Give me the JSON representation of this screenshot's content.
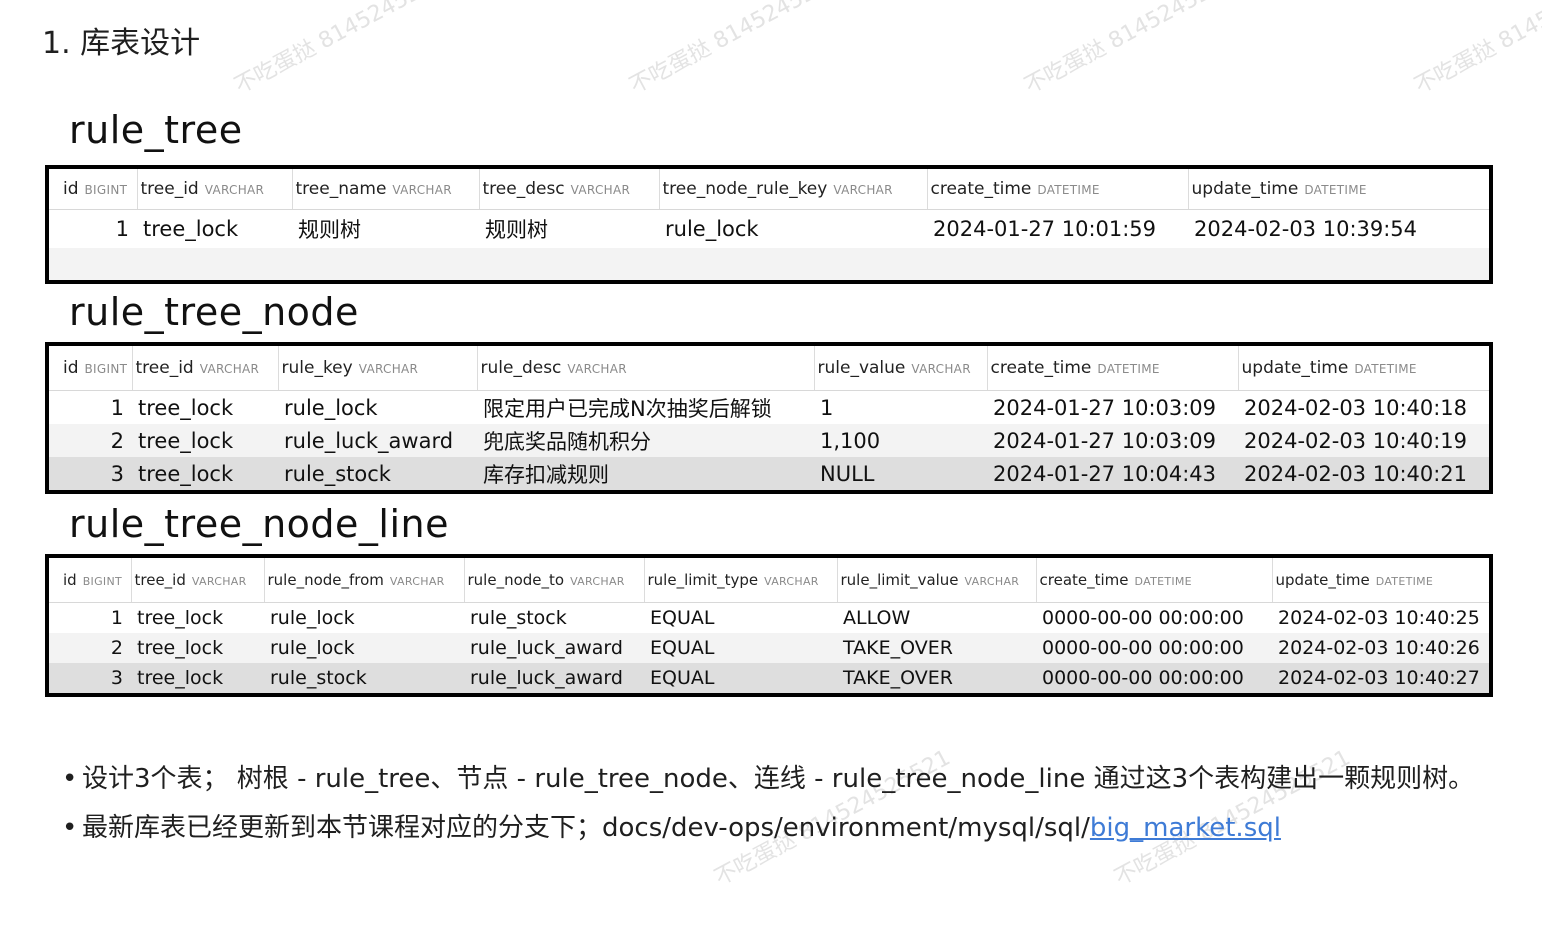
{
  "heading": "1. 库表设计",
  "watermark_text": "不吃蛋挞 814524525521",
  "tables": [
    {
      "name": "rule_tree",
      "columns": [
        {
          "name": "id",
          "type": "BIGINT"
        },
        {
          "name": "tree_id",
          "type": "VARCHAR"
        },
        {
          "name": "tree_name",
          "type": "VARCHAR"
        },
        {
          "name": "tree_desc",
          "type": "VARCHAR"
        },
        {
          "name": "tree_node_rule_key",
          "type": "VARCHAR"
        },
        {
          "name": "create_time",
          "type": "DATETIME"
        },
        {
          "name": "update_time",
          "type": "DATETIME"
        }
      ],
      "rows": [
        [
          "1",
          "tree_lock",
          "规则树",
          "规则树",
          "rule_lock",
          "2024-01-27 10:01:59",
          "2024-02-03 10:39:54"
        ]
      ]
    },
    {
      "name": "rule_tree_node",
      "columns": [
        {
          "name": "id",
          "type": "BIGINT"
        },
        {
          "name": "tree_id",
          "type": "VARCHAR"
        },
        {
          "name": "rule_key",
          "type": "VARCHAR"
        },
        {
          "name": "rule_desc",
          "type": "VARCHAR"
        },
        {
          "name": "rule_value",
          "type": "VARCHAR"
        },
        {
          "name": "create_time",
          "type": "DATETIME"
        },
        {
          "name": "update_time",
          "type": "DATETIME"
        }
      ],
      "rows": [
        [
          "1",
          "tree_lock",
          "rule_lock",
          "限定用户已完成N次抽奖后解锁",
          "1",
          "2024-01-27 10:03:09",
          "2024-02-03 10:40:18"
        ],
        [
          "2",
          "tree_lock",
          "rule_luck_award",
          "兜底奖品随机积分",
          "1,100",
          "2024-01-27 10:03:09",
          "2024-02-03 10:40:19"
        ],
        [
          "3",
          "tree_lock",
          "rule_stock",
          "库存扣减规则",
          "NULL",
          "2024-01-27 10:04:43",
          "2024-02-03 10:40:21"
        ]
      ]
    },
    {
      "name": "rule_tree_node_line",
      "columns": [
        {
          "name": "id",
          "type": "BIGINT"
        },
        {
          "name": "tree_id",
          "type": "VARCHAR"
        },
        {
          "name": "rule_node_from",
          "type": "VARCHAR"
        },
        {
          "name": "rule_node_to",
          "type": "VARCHAR"
        },
        {
          "name": "rule_limit_type",
          "type": "VARCHAR"
        },
        {
          "name": "rule_limit_value",
          "type": "VARCHAR"
        },
        {
          "name": "create_time",
          "type": "DATETIME"
        },
        {
          "name": "update_time",
          "type": "DATETIME"
        }
      ],
      "rows": [
        [
          "1",
          "tree_lock",
          "rule_lock",
          "rule_stock",
          "EQUAL",
          "ALLOW",
          "0000-00-00 00:00:00",
          "2024-02-03 10:40:25"
        ],
        [
          "2",
          "tree_lock",
          "rule_lock",
          "rule_luck_award",
          "EQUAL",
          "TAKE_OVER",
          "0000-00-00 00:00:00",
          "2024-02-03 10:40:26"
        ],
        [
          "3",
          "tree_lock",
          "rule_stock",
          "rule_luck_award",
          "EQUAL",
          "TAKE_OVER",
          "0000-00-00 00:00:00",
          "2024-02-03 10:40:27"
        ]
      ]
    }
  ],
  "bullets": {
    "b1": "设计3个表； 树根 - rule_tree、节点 - rule_tree_node、连线 - rule_tree_node_line 通过这3个表构建出一颗规则树。",
    "b2_text": "最新库表已经更新到本节课程对应的分支下；docs/dev-ops/environment/mysql/sql/",
    "b2_link": "big_market.sql"
  },
  "colors": {
    "border": "#000000",
    "link": "#3e7bd6",
    "row_alt": "#f3f3f3",
    "row_selected": "#dedede"
  }
}
